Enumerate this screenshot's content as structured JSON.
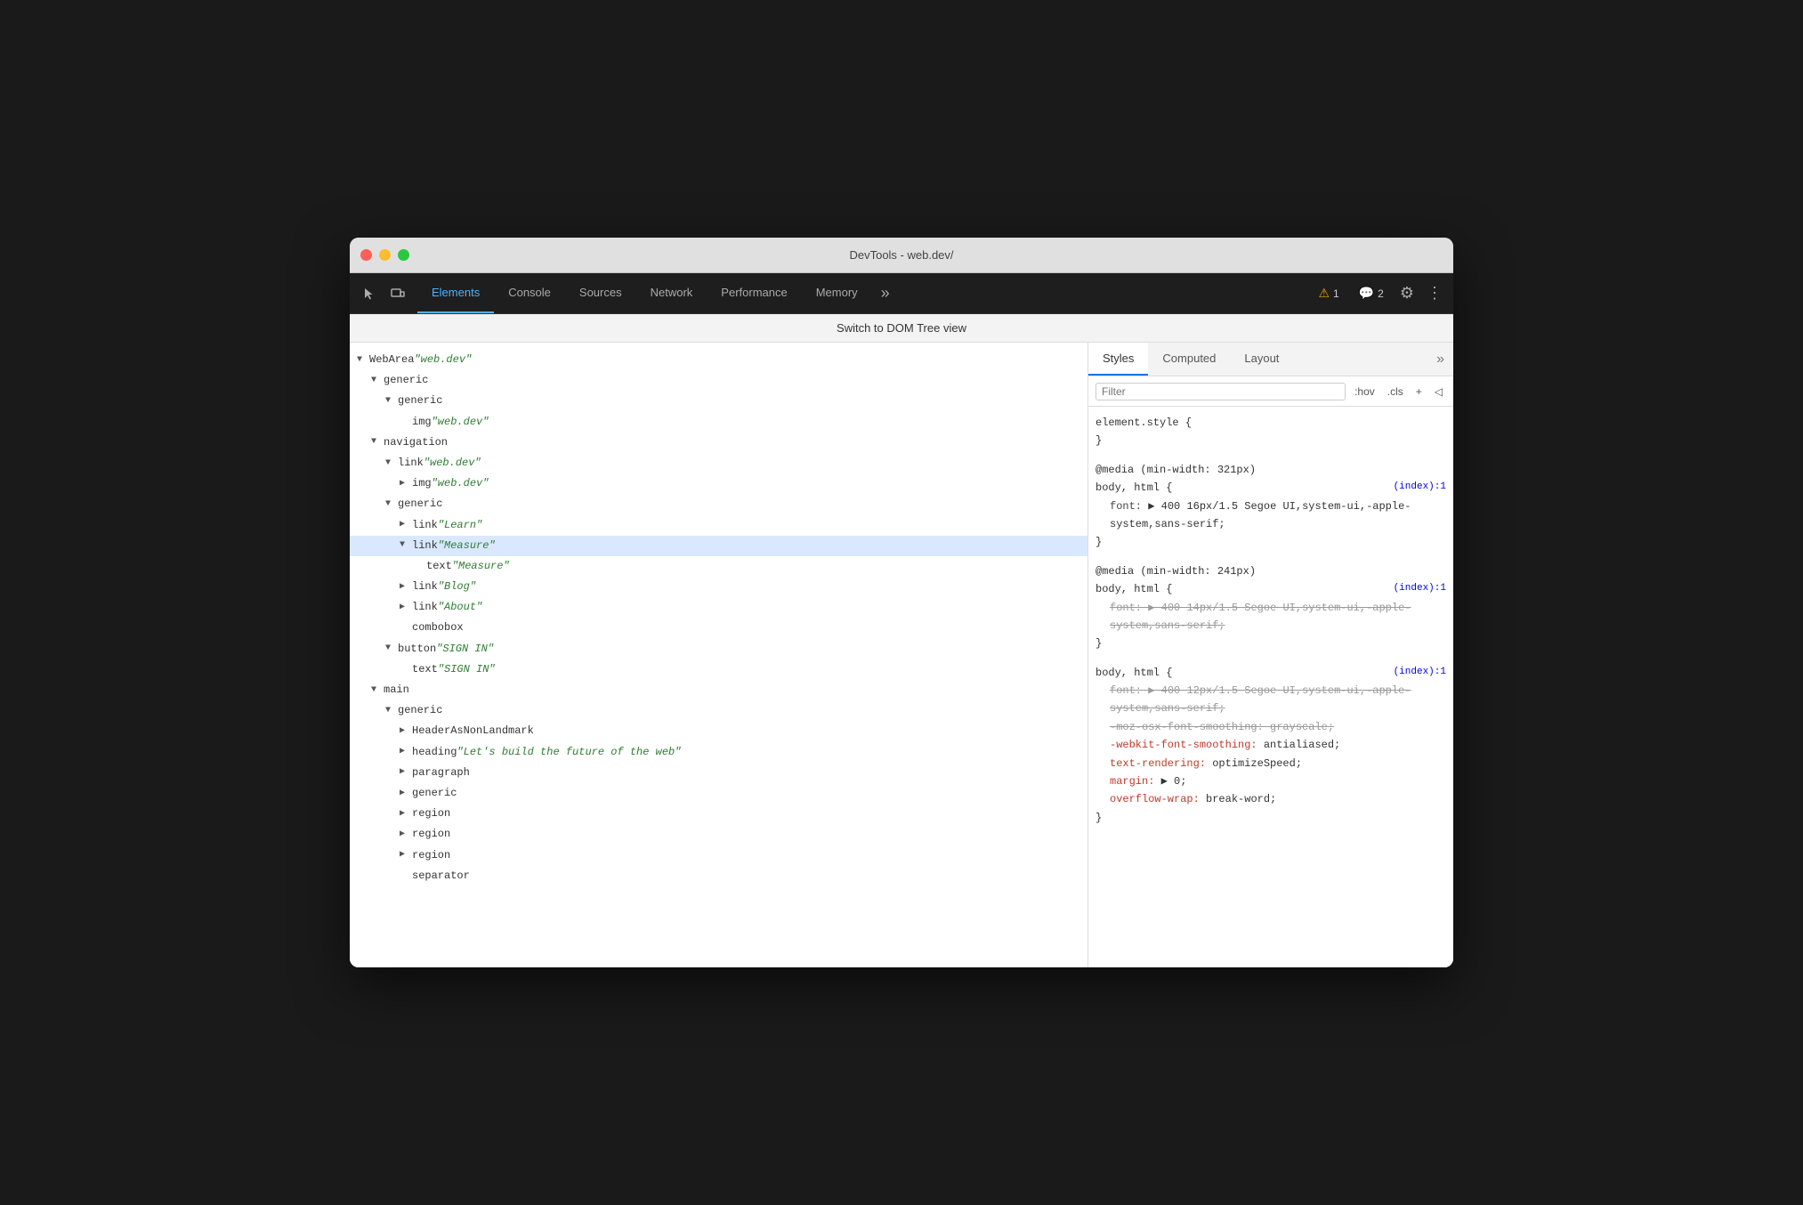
{
  "window": {
    "title": "DevTools - web.dev/"
  },
  "tabs": [
    {
      "id": "cursor",
      "label": "⬡",
      "icon": true
    },
    {
      "id": "responsive",
      "label": "□",
      "icon": true
    },
    {
      "id": "elements",
      "label": "Elements",
      "active": true
    },
    {
      "id": "console",
      "label": "Console"
    },
    {
      "id": "sources",
      "label": "Sources"
    },
    {
      "id": "network",
      "label": "Network"
    },
    {
      "id": "performance",
      "label": "Performance"
    },
    {
      "id": "memory",
      "label": "Memory"
    },
    {
      "id": "more",
      "label": "»"
    }
  ],
  "badges": {
    "warn": {
      "icon": "⚠",
      "count": "1"
    },
    "info": {
      "icon": "💬",
      "count": "2"
    }
  },
  "switch_bar": {
    "text": "Switch to DOM Tree view"
  },
  "dom_tree": [
    {
      "level": 0,
      "arrow": "open",
      "text_parts": [
        {
          "type": "arrow-open"
        },
        {
          "type": "node",
          "text": "WebArea "
        },
        {
          "type": "string",
          "text": "\"web.dev\""
        }
      ]
    },
    {
      "level": 1,
      "arrow": "open",
      "text_parts": [
        {
          "type": "arrow-open"
        },
        {
          "type": "node",
          "text": "generic"
        }
      ]
    },
    {
      "level": 2,
      "arrow": "open",
      "text_parts": [
        {
          "type": "arrow-open"
        },
        {
          "type": "node",
          "text": "generic"
        }
      ]
    },
    {
      "level": 3,
      "arrow": "empty",
      "text_parts": [
        {
          "type": "arrow-none"
        },
        {
          "type": "node",
          "text": "img "
        },
        {
          "type": "string",
          "text": "\"web.dev\""
        }
      ]
    },
    {
      "level": 1,
      "arrow": "open",
      "text_parts": [
        {
          "type": "arrow-open"
        },
        {
          "type": "node",
          "text": "navigation"
        }
      ]
    },
    {
      "level": 2,
      "arrow": "open",
      "text_parts": [
        {
          "type": "arrow-open"
        },
        {
          "type": "node",
          "text": "link "
        },
        {
          "type": "string",
          "text": "\"web.dev\""
        }
      ]
    },
    {
      "level": 3,
      "arrow": "closed",
      "text_parts": [
        {
          "type": "arrow-closed"
        },
        {
          "type": "node",
          "text": "img "
        },
        {
          "type": "string",
          "text": "\"web.dev\""
        }
      ]
    },
    {
      "level": 2,
      "arrow": "open",
      "text_parts": [
        {
          "type": "arrow-open"
        },
        {
          "type": "node",
          "text": "generic"
        }
      ]
    },
    {
      "level": 3,
      "arrow": "closed",
      "text_parts": [
        {
          "type": "arrow-closed"
        },
        {
          "type": "node",
          "text": "link "
        },
        {
          "type": "string",
          "text": "\"Learn\""
        }
      ]
    },
    {
      "level": 3,
      "arrow": "open",
      "selected": true,
      "text_parts": [
        {
          "type": "arrow-open"
        },
        {
          "type": "node",
          "text": "link "
        },
        {
          "type": "string",
          "text": "\"Measure\""
        }
      ]
    },
    {
      "level": 4,
      "arrow": "empty",
      "text_parts": [
        {
          "type": "arrow-none"
        },
        {
          "type": "node",
          "text": "text "
        },
        {
          "type": "string",
          "text": "\"Measure\""
        }
      ]
    },
    {
      "level": 3,
      "arrow": "closed",
      "text_parts": [
        {
          "type": "arrow-closed"
        },
        {
          "type": "node",
          "text": "link "
        },
        {
          "type": "string",
          "text": "\"Blog\""
        }
      ]
    },
    {
      "level": 3,
      "arrow": "closed",
      "text_parts": [
        {
          "type": "arrow-closed"
        },
        {
          "type": "node",
          "text": "link "
        },
        {
          "type": "string",
          "text": "\"About\""
        }
      ]
    },
    {
      "level": 3,
      "arrow": "empty",
      "text_parts": [
        {
          "type": "arrow-none"
        },
        {
          "type": "node",
          "text": "combobox"
        }
      ]
    },
    {
      "level": 2,
      "arrow": "open",
      "text_parts": [
        {
          "type": "arrow-open"
        },
        {
          "type": "node",
          "text": "button "
        },
        {
          "type": "string",
          "text": "\"SIGN IN\""
        }
      ]
    },
    {
      "level": 3,
      "arrow": "empty",
      "text_parts": [
        {
          "type": "arrow-none"
        },
        {
          "type": "node",
          "text": "text "
        },
        {
          "type": "string",
          "text": "\"SIGN IN\""
        }
      ]
    },
    {
      "level": 1,
      "arrow": "open",
      "text_parts": [
        {
          "type": "arrow-open"
        },
        {
          "type": "node",
          "text": "main"
        }
      ]
    },
    {
      "level": 2,
      "arrow": "open",
      "text_parts": [
        {
          "type": "arrow-open"
        },
        {
          "type": "node",
          "text": "generic"
        }
      ]
    },
    {
      "level": 3,
      "arrow": "closed",
      "text_parts": [
        {
          "type": "arrow-closed"
        },
        {
          "type": "node",
          "text": "HeaderAsNonLandmark"
        }
      ]
    },
    {
      "level": 3,
      "arrow": "closed",
      "text_parts": [
        {
          "type": "arrow-closed"
        },
        {
          "type": "node",
          "text": "heading "
        },
        {
          "type": "string",
          "text": "\"Let's build the future of the web\""
        }
      ]
    },
    {
      "level": 3,
      "arrow": "closed",
      "text_parts": [
        {
          "type": "arrow-closed"
        },
        {
          "type": "node",
          "text": "paragraph"
        }
      ]
    },
    {
      "level": 3,
      "arrow": "closed",
      "text_parts": [
        {
          "type": "arrow-closed"
        },
        {
          "type": "node",
          "text": "generic"
        }
      ]
    },
    {
      "level": 3,
      "arrow": "closed",
      "text_parts": [
        {
          "type": "arrow-closed"
        },
        {
          "type": "node",
          "text": "region"
        }
      ]
    },
    {
      "level": 3,
      "arrow": "closed",
      "text_parts": [
        {
          "type": "arrow-closed"
        },
        {
          "type": "node",
          "text": "region"
        }
      ]
    },
    {
      "level": 3,
      "arrow": "closed",
      "text_parts": [
        {
          "type": "arrow-closed"
        },
        {
          "type": "node",
          "text": "region"
        }
      ]
    },
    {
      "level": 3,
      "arrow": "empty",
      "text_parts": [
        {
          "type": "arrow-none"
        },
        {
          "type": "node",
          "text": "separator"
        }
      ]
    }
  ],
  "styles_panel": {
    "tabs": [
      {
        "id": "styles",
        "label": "Styles",
        "active": true
      },
      {
        "id": "computed",
        "label": "Computed"
      },
      {
        "id": "layout",
        "label": "Layout"
      },
      {
        "id": "more",
        "label": "»"
      }
    ],
    "filter": {
      "placeholder": "Filter",
      "hov_btn": ":hov",
      "cls_btn": ".cls",
      "plus_btn": "+",
      "collapse_btn": "◁"
    },
    "rules": [
      {
        "selector": "element.style {",
        "closing": "}",
        "properties": []
      },
      {
        "at_rule": "@media (min-width: 321px)",
        "selector": "body, html {",
        "file": "(index):1",
        "closing": "}",
        "properties": [
          {
            "name": "font:",
            "value": "▶ 400 16px/1.5 Segoe UI,system-ui,-apple-system,sans-serif;",
            "strikethrough": false,
            "red": false
          }
        ]
      },
      {
        "at_rule": "@media (min-width: 241px)",
        "selector": "body, html {",
        "file": "(index):1",
        "closing": "}",
        "properties": [
          {
            "name": "font:",
            "value": "▶ 400 14px/1.5 Segoe UI,system-ui,-apple-system,sans-serif;",
            "strikethrough": true,
            "red": false
          }
        ]
      },
      {
        "selector": "body, html {",
        "file": "(index):1",
        "closing": "}",
        "properties": [
          {
            "name": "font:",
            "value": "▶ 400 12px/1.5 Segoe UI,system-ui,-apple-system,sans-serif;",
            "strikethrough": true,
            "red": false
          },
          {
            "name": "-moz-osx-font-smoothing:",
            "value": "grayscale;",
            "strikethrough": true,
            "red": false
          },
          {
            "name": "-webkit-font-smoothing:",
            "value": "antialiased;",
            "strikethrough": false,
            "red": true
          },
          {
            "name": "text-rendering:",
            "value": "optimizeSpeed;",
            "strikethrough": false,
            "red": true
          },
          {
            "name": "margin:",
            "value": "▶ 0;",
            "strikethrough": false,
            "red": true
          },
          {
            "name": "overflow-wrap:",
            "value": "break-word;",
            "strikethrough": false,
            "red": true
          }
        ]
      }
    ]
  }
}
